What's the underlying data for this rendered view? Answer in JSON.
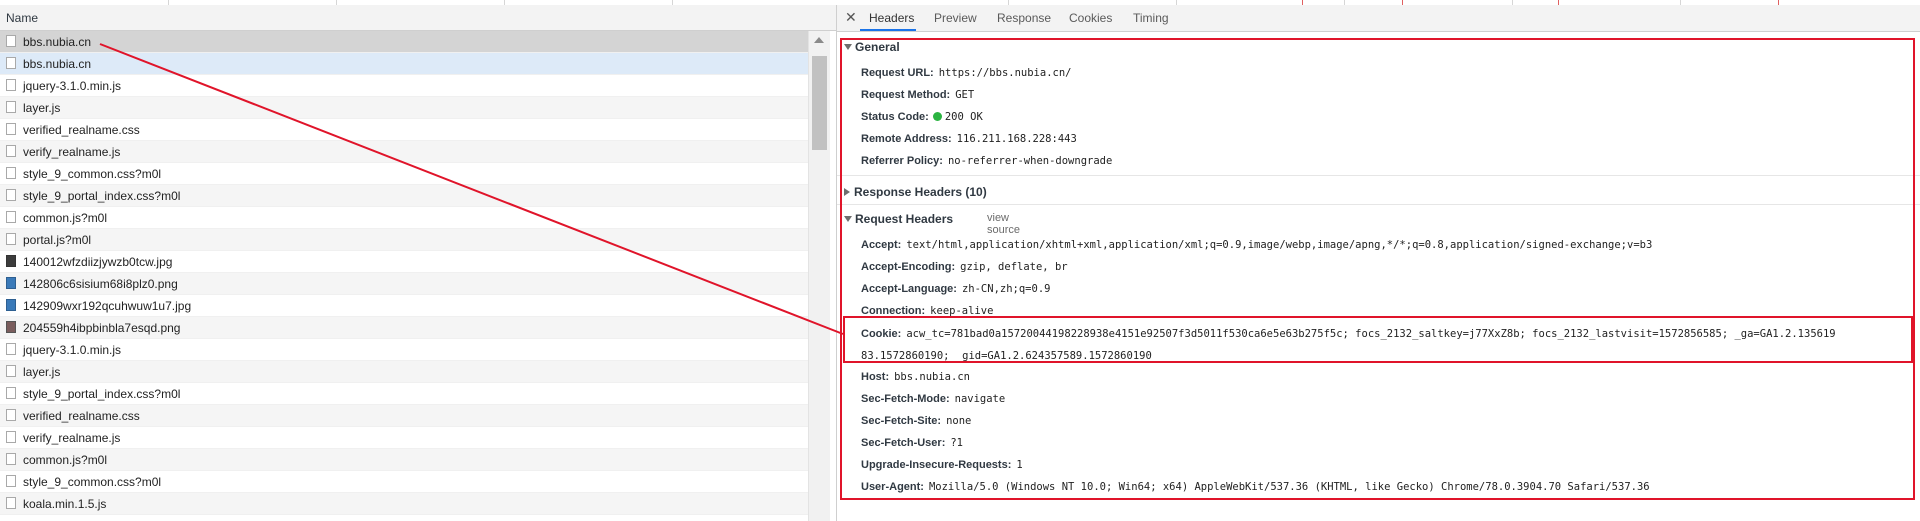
{
  "list": {
    "column_name": "Name",
    "rows": [
      {
        "name": "bbs.nubia.cn",
        "icon": "document-icon",
        "state": "grey"
      },
      {
        "name": "bbs.nubia.cn",
        "icon": "document-icon",
        "state": "blue"
      },
      {
        "name": "jquery-3.1.0.min.js",
        "icon": "script-icon"
      },
      {
        "name": "layer.js",
        "icon": "script-icon"
      },
      {
        "name": "verified_realname.css",
        "icon": "stylesheet-icon"
      },
      {
        "name": "verify_realname.js",
        "icon": "script-icon"
      },
      {
        "name": "style_9_common.css?m0l",
        "icon": "stylesheet-icon"
      },
      {
        "name": "style_9_portal_index.css?m0l",
        "icon": "stylesheet-icon"
      },
      {
        "name": "common.js?m0l",
        "icon": "script-icon"
      },
      {
        "name": "portal.js?m0l",
        "icon": "script-icon"
      },
      {
        "name": "140012wfzdiizjywzb0tcw.jpg",
        "icon": "image-icon"
      },
      {
        "name": "142806c6sisium68i8plz0.png",
        "icon": "image-icon"
      },
      {
        "name": "142909wxr192qcuhwuw1u7.jpg",
        "icon": "image-icon"
      },
      {
        "name": "204559h4ibpbinbla7esqd.png",
        "icon": "image-icon"
      },
      {
        "name": "jquery-3.1.0.min.js",
        "icon": "script-icon"
      },
      {
        "name": "layer.js",
        "icon": "script-icon"
      },
      {
        "name": "style_9_portal_index.css?m0l",
        "icon": "stylesheet-icon"
      },
      {
        "name": "verified_realname.css",
        "icon": "stylesheet-icon"
      },
      {
        "name": "verify_realname.js",
        "icon": "script-icon"
      },
      {
        "name": "common.js?m0l",
        "icon": "script-icon"
      },
      {
        "name": "style_9_common.css?m0l",
        "icon": "stylesheet-icon"
      },
      {
        "name": "koala.min.1.5.js",
        "icon": "script-icon"
      }
    ]
  },
  "tabs": [
    "Headers",
    "Preview",
    "Response",
    "Cookies",
    "Timing"
  ],
  "general": {
    "title": "General",
    "rows": [
      {
        "k": "Request URL:",
        "v": "https://bbs.nubia.cn/"
      },
      {
        "k": "Request Method:",
        "v": "GET"
      },
      {
        "k": "Status Code:",
        "v": "200 OK"
      },
      {
        "k": "Remote Address:",
        "v": "116.211.168.228:443"
      },
      {
        "k": "Referrer Policy:",
        "v": "no-referrer-when-downgrade"
      }
    ]
  },
  "response_headers": {
    "title": "Response Headers (10)"
  },
  "request_headers": {
    "title": "Request Headers",
    "view_source": "view source",
    "rows": [
      {
        "k": "Accept:",
        "v": "text/html,application/xhtml+xml,application/xml;q=0.9,image/webp,image/apng,*/*;q=0.8,application/signed-exchange;v=b3"
      },
      {
        "k": "Accept-Encoding:",
        "v": "gzip, deflate, br"
      },
      {
        "k": "Accept-Language:",
        "v": "zh-CN,zh;q=0.9"
      },
      {
        "k": "Connection:",
        "v": "keep-alive"
      }
    ],
    "cookie_key": "Cookie:",
    "cookie_line1": "acw_tc=781bad0a15720044198228938e4151e92507f3d5011f530ca6e5e63b275f5c; focs_2132_saltkey=j77XxZ8b; focs_2132_lastvisit=1572856585; _ga=GA1.2.135619",
    "cookie_line2": "83.1572860190; _gid=GA1.2.624357589.1572860190",
    "rows_after": [
      {
        "k": "Host:",
        "v": "bbs.nubia.cn"
      },
      {
        "k": "Sec-Fetch-Mode:",
        "v": "navigate"
      },
      {
        "k": "Sec-Fetch-Site:",
        "v": "none"
      },
      {
        "k": "Sec-Fetch-User:",
        "v": "?1"
      },
      {
        "k": "Upgrade-Insecure-Requests:",
        "v": "1"
      },
      {
        "k": "User-Agent:",
        "v": "Mozilla/5.0 (Windows NT 10.0; Win64; x64) AppleWebKit/537.36 (KHTML, like Gecko) Chrome/78.0.3904.70 Safari/537.36"
      }
    ]
  },
  "colors": {
    "annotation": "#e0142a",
    "status_ok": "#2bb341",
    "tab_accent": "#1a73e8"
  }
}
